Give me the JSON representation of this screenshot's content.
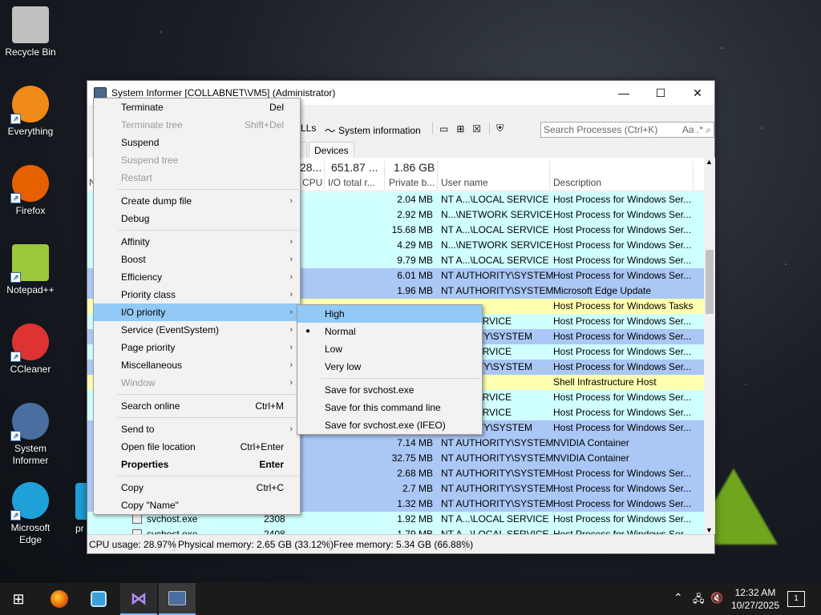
{
  "desktop": {
    "icons": [
      {
        "label": "Recycle Bin",
        "icon": "recycle-bin-icon",
        "color": "#c0c0c0"
      },
      {
        "label": "Everything",
        "icon": "search-icon",
        "color": "#f08a18"
      },
      {
        "label": "Firefox",
        "icon": "firefox-icon",
        "color": "#e66000"
      },
      {
        "label": "Notepad++",
        "icon": "notepad-icon",
        "color": "#9cc83c"
      },
      {
        "label": "CCleaner",
        "icon": "ccleaner-icon",
        "color": "#d33"
      },
      {
        "label": "System Informer",
        "icon": "gear-icon",
        "color": "#4a6ea0"
      },
      {
        "label": "Microsoft Edge",
        "icon": "edge-icon",
        "color": "#1fa1d8"
      }
    ],
    "partial_label": "pr"
  },
  "window": {
    "title": "System Informer [COLLABNET\\VM5] (Administrator)",
    "minimize": "—",
    "maximize": "☐",
    "close": "✕",
    "toolbar": {
      "dlls_label": "LLs",
      "sysinfo_label": "System information",
      "search_placeholder": "Search Processes (Ctrl+K)",
      "search_opts": "Aa .*"
    },
    "tabs": {
      "partial": "l",
      "devices": "Devices"
    },
    "header": {
      "cpu_total": "28...",
      "io_total": "651.87 ...",
      "private_total": "1.86 GB",
      "cpu": "CPU",
      "io": "I/O total r...",
      "private": "Private b...",
      "user": "User name",
      "description": "Description",
      "name_partial": "N"
    },
    "rows": [
      {
        "mem": "2.04 MB",
        "user": "NT A...\\LOCAL SERVICE",
        "desc": "Host Process for Windows Ser...",
        "kind": "svc"
      },
      {
        "mem": "2.92 MB",
        "user": "N...\\NETWORK SERVICE",
        "desc": "Host Process for Windows Ser...",
        "kind": "svc"
      },
      {
        "mem": "15.68 MB",
        "user": "NT A...\\LOCAL SERVICE",
        "desc": "Host Process for Windows Ser...",
        "kind": "svc"
      },
      {
        "mem": "4.29 MB",
        "user": "N...\\NETWORK SERVICE",
        "desc": "Host Process for Windows Ser...",
        "kind": "svc"
      },
      {
        "mem": "9.79 MB",
        "user": "NT A...\\LOCAL SERVICE",
        "desc": "Host Process for Windows Ser...",
        "kind": "svc"
      },
      {
        "mem": "6.01 MB",
        "user": "NT AUTHORITY\\SYSTEM",
        "desc": "Host Process for Windows Ser...",
        "kind": "sys"
      },
      {
        "mem": "1.96 MB",
        "user": "NT AUTHORITY\\SYSTEM",
        "desc": "Microsoft Edge Update",
        "kind": "sys"
      },
      {
        "mem": "",
        "user": "",
        "desc": "Host Process for Windows Tasks",
        "kind": "usr"
      },
      {
        "mem": "",
        "user": "OCAL SERVICE",
        "desc": "Host Process for Windows Ser...",
        "kind": "svc"
      },
      {
        "mem": "",
        "user": "UTHORITY\\SYSTEM",
        "desc": "Host Process for Windows Ser...",
        "kind": "sys"
      },
      {
        "mem": "",
        "user": "OCAL SERVICE",
        "desc": "Host Process for Windows Ser...",
        "kind": "svc"
      },
      {
        "mem": "",
        "user": "UTHORITY\\SYSTEM",
        "desc": "Host Process for Windows Ser...",
        "kind": "sys"
      },
      {
        "mem": "",
        "user": "ET\\VM5",
        "desc": "Shell Infrastructure Host",
        "kind": "usr"
      },
      {
        "mem": "",
        "user": "OCAL SERVICE",
        "desc": "Host Process for Windows Ser...",
        "kind": "svc"
      },
      {
        "mem": "",
        "user": "OCAL SERVICE",
        "desc": "Host Process for Windows Ser...",
        "kind": "svc"
      },
      {
        "mem": "",
        "user": "UTHORITY\\SYSTEM",
        "desc": "Host Process for Windows Ser...",
        "kind": "sys"
      },
      {
        "mem": "7.14 MB",
        "user": "NT AUTHORITY\\SYSTEM",
        "desc": "NVIDIA Container",
        "kind": "sys"
      },
      {
        "mem": "32.75 MB",
        "user": "NT AUTHORITY\\SYSTEM",
        "desc": "NVIDIA Container",
        "kind": "sys"
      },
      {
        "mem": "2.68 MB",
        "user": "NT AUTHORITY\\SYSTEM",
        "desc": "Host Process for Windows Ser...",
        "kind": "sys"
      },
      {
        "mem": "2.7 MB",
        "user": "NT AUTHORITY\\SYSTEM",
        "desc": "Host Process for Windows Ser...",
        "kind": "sys"
      },
      {
        "mem": "1.32 MB",
        "user": "NT AUTHORITY\\SYSTEM",
        "desc": "Host Process for Windows Ser...",
        "kind": "sys"
      },
      {
        "mem": "1.92 MB",
        "user": "NT A...\\LOCAL SERVICE",
        "desc": "Host Process for Windows Ser...",
        "kind": "svc",
        "name": "svchost.exe",
        "pid": "2308"
      },
      {
        "mem": "1.79 MB",
        "user": "NT A...\\LOCAL SERVICE",
        "desc": "Host Process for Windows Ser...",
        "kind": "svc",
        "name": "svchost.exe",
        "pid": "2408"
      }
    ],
    "status": {
      "cpu": "CPU usage: 28.97%",
      "physical": "Physical memory: 2.65 GB (33.12%)",
      "free": "Free memory: 5.34 GB (66.88%)"
    }
  },
  "context_menu": {
    "items": [
      {
        "label": "Terminate",
        "shortcut": "Del"
      },
      {
        "label": "Terminate tree",
        "shortcut": "Shift+Del",
        "disabled": true
      },
      {
        "label": "Suspend"
      },
      {
        "label": "Suspend tree",
        "disabled": true
      },
      {
        "label": "Restart",
        "disabled": true
      },
      {
        "sep": true
      },
      {
        "label": "Create dump file",
        "submenu": true
      },
      {
        "label": "Debug"
      },
      {
        "sep": true
      },
      {
        "label": "Affinity",
        "submenu": true
      },
      {
        "label": "Boost",
        "submenu": true
      },
      {
        "label": "Efficiency",
        "submenu": true
      },
      {
        "label": "Priority class",
        "submenu": true
      },
      {
        "label": "I/O priority",
        "submenu": true,
        "highlight": true
      },
      {
        "label": "Service (EventSystem)",
        "submenu": true
      },
      {
        "label": "Page priority",
        "submenu": true
      },
      {
        "label": "Miscellaneous",
        "submenu": true
      },
      {
        "label": "Window",
        "submenu": true,
        "disabled": true
      },
      {
        "sep": true
      },
      {
        "label": "Search online",
        "shortcut": "Ctrl+M"
      },
      {
        "sep": true
      },
      {
        "label": "Send to",
        "submenu": true
      },
      {
        "label": "Open file location",
        "shortcut": "Ctrl+Enter"
      },
      {
        "label": "Properties",
        "shortcut": "Enter",
        "bold": true
      },
      {
        "sep": true
      },
      {
        "label": "Copy",
        "shortcut": "Ctrl+C"
      },
      {
        "label": "Copy \"Name\""
      }
    ]
  },
  "io_submenu": {
    "items": [
      {
        "label": "High",
        "highlight": true
      },
      {
        "label": "Normal",
        "checked": true
      },
      {
        "label": "Low"
      },
      {
        "label": "Very low"
      },
      {
        "sep": true
      },
      {
        "label": "Save for svchost.exe"
      },
      {
        "label": "Save for this command line"
      },
      {
        "label": "Save for svchost.exe (IFEO)"
      }
    ]
  },
  "taskbar": {
    "time": "12:32 AM",
    "date": "10/27/2025",
    "notification_count": "1"
  }
}
